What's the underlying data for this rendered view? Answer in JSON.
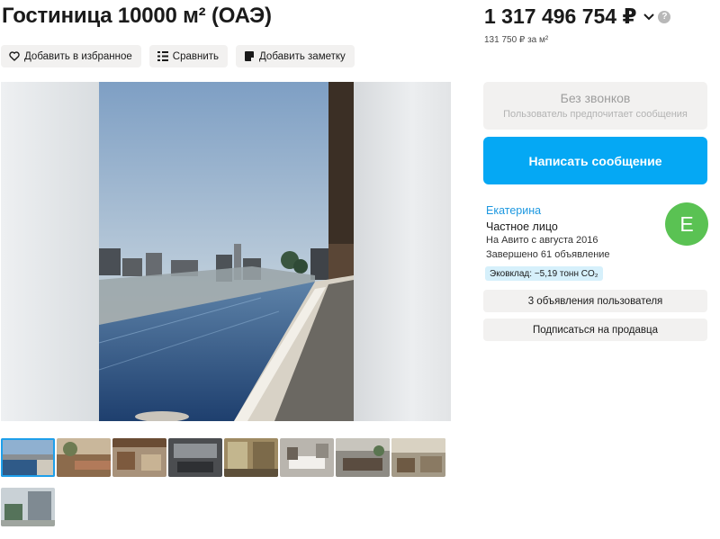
{
  "listing": {
    "title": "Гостиница 10000 м² (ОАЭ)"
  },
  "actions": {
    "favorite_label": "Добавить в избранное",
    "compare_label": "Сравнить",
    "note_label": "Добавить заметку"
  },
  "price": {
    "value": "1 317 496 754 ₽",
    "help": "?",
    "per_meter": "131 750 ₽ за м²"
  },
  "contact": {
    "no_calls_title": "Без звонков",
    "no_calls_subtitle": "Пользователь предпочитает сообщения",
    "write_label": "Написать сообщение"
  },
  "seller": {
    "name": "Екатерина",
    "type": "Частное лицо",
    "since": "На Авито с августа 2016",
    "completed": "Завершено 61 объявление",
    "eco": "Эковклад: −5,19 тонн CO₂",
    "avatar_letter": "Е",
    "ads_label": "3 объявления пользователя",
    "subscribe_label": "Подписаться на продавца"
  },
  "colors": {
    "accent": "#05a8f4",
    "link": "#1d98e0",
    "avatar": "#5ac253",
    "button_bg": "#f2f1f0"
  },
  "gallery": {
    "thumbnail_count": 9,
    "active_thumbnail": 1
  }
}
